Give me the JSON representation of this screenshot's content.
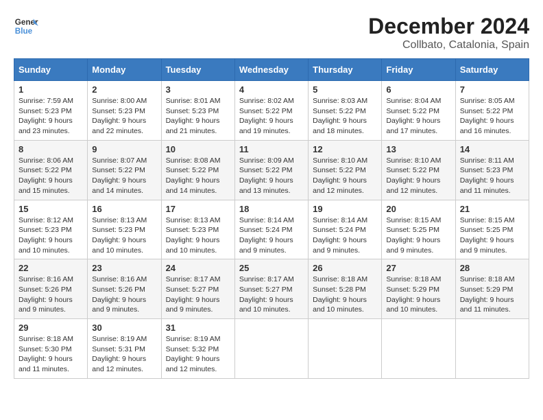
{
  "logo": {
    "text_general": "General",
    "text_blue": "Blue"
  },
  "title": "December 2024",
  "subtitle": "Collbato, Catalonia, Spain",
  "days_header": [
    "Sunday",
    "Monday",
    "Tuesday",
    "Wednesday",
    "Thursday",
    "Friday",
    "Saturday"
  ],
  "weeks": [
    [
      {
        "day": "1",
        "sunrise": "Sunrise: 7:59 AM",
        "sunset": "Sunset: 5:23 PM",
        "daylight": "Daylight: 9 hours and 23 minutes."
      },
      {
        "day": "2",
        "sunrise": "Sunrise: 8:00 AM",
        "sunset": "Sunset: 5:23 PM",
        "daylight": "Daylight: 9 hours and 22 minutes."
      },
      {
        "day": "3",
        "sunrise": "Sunrise: 8:01 AM",
        "sunset": "Sunset: 5:23 PM",
        "daylight": "Daylight: 9 hours and 21 minutes."
      },
      {
        "day": "4",
        "sunrise": "Sunrise: 8:02 AM",
        "sunset": "Sunset: 5:22 PM",
        "daylight": "Daylight: 9 hours and 19 minutes."
      },
      {
        "day": "5",
        "sunrise": "Sunrise: 8:03 AM",
        "sunset": "Sunset: 5:22 PM",
        "daylight": "Daylight: 9 hours and 18 minutes."
      },
      {
        "day": "6",
        "sunrise": "Sunrise: 8:04 AM",
        "sunset": "Sunset: 5:22 PM",
        "daylight": "Daylight: 9 hours and 17 minutes."
      },
      {
        "day": "7",
        "sunrise": "Sunrise: 8:05 AM",
        "sunset": "Sunset: 5:22 PM",
        "daylight": "Daylight: 9 hours and 16 minutes."
      }
    ],
    [
      {
        "day": "8",
        "sunrise": "Sunrise: 8:06 AM",
        "sunset": "Sunset: 5:22 PM",
        "daylight": "Daylight: 9 hours and 15 minutes."
      },
      {
        "day": "9",
        "sunrise": "Sunrise: 8:07 AM",
        "sunset": "Sunset: 5:22 PM",
        "daylight": "Daylight: 9 hours and 14 minutes."
      },
      {
        "day": "10",
        "sunrise": "Sunrise: 8:08 AM",
        "sunset": "Sunset: 5:22 PM",
        "daylight": "Daylight: 9 hours and 14 minutes."
      },
      {
        "day": "11",
        "sunrise": "Sunrise: 8:09 AM",
        "sunset": "Sunset: 5:22 PM",
        "daylight": "Daylight: 9 hours and 13 minutes."
      },
      {
        "day": "12",
        "sunrise": "Sunrise: 8:10 AM",
        "sunset": "Sunset: 5:22 PM",
        "daylight": "Daylight: 9 hours and 12 minutes."
      },
      {
        "day": "13",
        "sunrise": "Sunrise: 8:10 AM",
        "sunset": "Sunset: 5:22 PM",
        "daylight": "Daylight: 9 hours and 12 minutes."
      },
      {
        "day": "14",
        "sunrise": "Sunrise: 8:11 AM",
        "sunset": "Sunset: 5:23 PM",
        "daylight": "Daylight: 9 hours and 11 minutes."
      }
    ],
    [
      {
        "day": "15",
        "sunrise": "Sunrise: 8:12 AM",
        "sunset": "Sunset: 5:23 PM",
        "daylight": "Daylight: 9 hours and 10 minutes."
      },
      {
        "day": "16",
        "sunrise": "Sunrise: 8:13 AM",
        "sunset": "Sunset: 5:23 PM",
        "daylight": "Daylight: 9 hours and 10 minutes."
      },
      {
        "day": "17",
        "sunrise": "Sunrise: 8:13 AM",
        "sunset": "Sunset: 5:23 PM",
        "daylight": "Daylight: 9 hours and 10 minutes."
      },
      {
        "day": "18",
        "sunrise": "Sunrise: 8:14 AM",
        "sunset": "Sunset: 5:24 PM",
        "daylight": "Daylight: 9 hours and 9 minutes."
      },
      {
        "day": "19",
        "sunrise": "Sunrise: 8:14 AM",
        "sunset": "Sunset: 5:24 PM",
        "daylight": "Daylight: 9 hours and 9 minutes."
      },
      {
        "day": "20",
        "sunrise": "Sunrise: 8:15 AM",
        "sunset": "Sunset: 5:25 PM",
        "daylight": "Daylight: 9 hours and 9 minutes."
      },
      {
        "day": "21",
        "sunrise": "Sunrise: 8:15 AM",
        "sunset": "Sunset: 5:25 PM",
        "daylight": "Daylight: 9 hours and 9 minutes."
      }
    ],
    [
      {
        "day": "22",
        "sunrise": "Sunrise: 8:16 AM",
        "sunset": "Sunset: 5:26 PM",
        "daylight": "Daylight: 9 hours and 9 minutes."
      },
      {
        "day": "23",
        "sunrise": "Sunrise: 8:16 AM",
        "sunset": "Sunset: 5:26 PM",
        "daylight": "Daylight: 9 hours and 9 minutes."
      },
      {
        "day": "24",
        "sunrise": "Sunrise: 8:17 AM",
        "sunset": "Sunset: 5:27 PM",
        "daylight": "Daylight: 9 hours and 9 minutes."
      },
      {
        "day": "25",
        "sunrise": "Sunrise: 8:17 AM",
        "sunset": "Sunset: 5:27 PM",
        "daylight": "Daylight: 9 hours and 10 minutes."
      },
      {
        "day": "26",
        "sunrise": "Sunrise: 8:18 AM",
        "sunset": "Sunset: 5:28 PM",
        "daylight": "Daylight: 9 hours and 10 minutes."
      },
      {
        "day": "27",
        "sunrise": "Sunrise: 8:18 AM",
        "sunset": "Sunset: 5:29 PM",
        "daylight": "Daylight: 9 hours and 10 minutes."
      },
      {
        "day": "28",
        "sunrise": "Sunrise: 8:18 AM",
        "sunset": "Sunset: 5:29 PM",
        "daylight": "Daylight: 9 hours and 11 minutes."
      }
    ],
    [
      {
        "day": "29",
        "sunrise": "Sunrise: 8:18 AM",
        "sunset": "Sunset: 5:30 PM",
        "daylight": "Daylight: 9 hours and 11 minutes."
      },
      {
        "day": "30",
        "sunrise": "Sunrise: 8:19 AM",
        "sunset": "Sunset: 5:31 PM",
        "daylight": "Daylight: 9 hours and 12 minutes."
      },
      {
        "day": "31",
        "sunrise": "Sunrise: 8:19 AM",
        "sunset": "Sunset: 5:32 PM",
        "daylight": "Daylight: 9 hours and 12 minutes."
      },
      null,
      null,
      null,
      null
    ]
  ]
}
